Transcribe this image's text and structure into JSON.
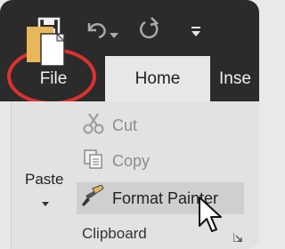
{
  "quick_access": {
    "icons": [
      "save-icon",
      "undo-icon",
      "redo-icon",
      "customize-qat-icon"
    ]
  },
  "tabs": [
    {
      "label": "File",
      "active": false,
      "highlighted": true
    },
    {
      "label": "Home",
      "active": true
    },
    {
      "label": "Inse",
      "active": false
    }
  ],
  "clipboard": {
    "paste_label": "Paste",
    "cut_label": "Cut",
    "copy_label": "Copy",
    "format_painter_label": "Format Painter",
    "group_label": "Clipboard"
  },
  "colors": {
    "title_bar": "#2b2b2b",
    "ribbon_bg": "#e2e2e2",
    "highlight_circle": "#e0312e",
    "disabled_text": "#8d8d8d"
  }
}
